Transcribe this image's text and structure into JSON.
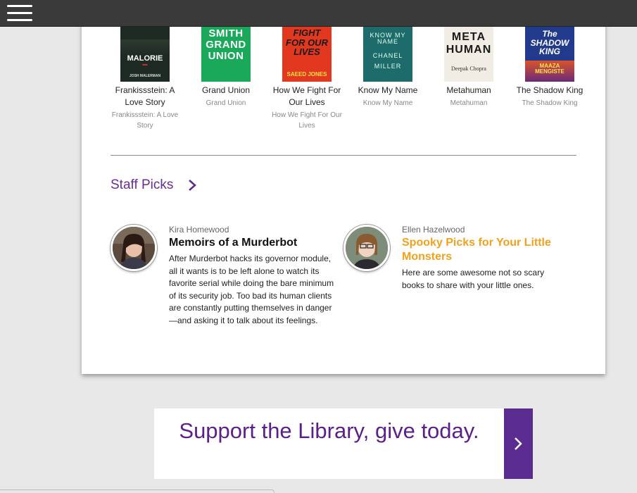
{
  "nav": {
    "menu_icon": "hamburger-menu-icon"
  },
  "books": [
    {
      "cover_text": "MALORIE",
      "cover_sub": "JOSH MALERMAN",
      "title": "Frankissstein: A Love Story",
      "subtitle": "Frankissstein: A Love Story",
      "cover_bg": "#1e2a24"
    },
    {
      "cover_text": "SMITH GRAND UNION",
      "cover_sub": "",
      "title": "Grand Union",
      "subtitle": "Grand Union",
      "cover_bg": "#1aa85a"
    },
    {
      "cover_text": "FIGHT FOR OUR LIVES",
      "cover_sub": "SAEED JONES",
      "title": "How We Fight For Our Lives",
      "subtitle": "How We Fight For Our Lives",
      "cover_bg": "#e2381f"
    },
    {
      "cover_text": "KNOW MY NAME",
      "cover_sub": "CHANEL MILLER",
      "title": "Know My Name",
      "subtitle": "Know My Name",
      "cover_bg": "#1d6b6b"
    },
    {
      "cover_text": "META HUMAN",
      "cover_sub": "Deepak Chopra",
      "title": "Metahuman",
      "subtitle": "Metahuman",
      "cover_bg": "#f1ede4"
    },
    {
      "cover_text": "The SHADOW KING",
      "cover_sub": "MAAZA MENGISTE",
      "title": "The Shadow King",
      "subtitle": "The Shadow King",
      "cover_bg": "#213a8c"
    }
  ],
  "staff": {
    "heading": "Staff Picks",
    "picks": [
      {
        "author": "Kira Homewood",
        "title": "Memoirs of a Murderbot",
        "description": "After Murderbot hacks its governor module, all it wants is to be left alone to watch its favorite serial while doing the bare minimum of its security job. Too bad its human clients are constantly putting themselves in danger—and asking it to talk about its feelings.",
        "title_color": "#111111"
      },
      {
        "author": "Ellen Hazelwood",
        "title": "Spooky Picks for Your Little Monsters",
        "description": "Here are some awesome not so scary books to share with your little ones.",
        "title_color": "#f0a21e"
      }
    ]
  },
  "support": {
    "text": "Support the Library, give today."
  },
  "colors": {
    "purple": "#6a2c91",
    "button_purple": "#5b2c8f",
    "topbar": "#3a3a3a"
  }
}
